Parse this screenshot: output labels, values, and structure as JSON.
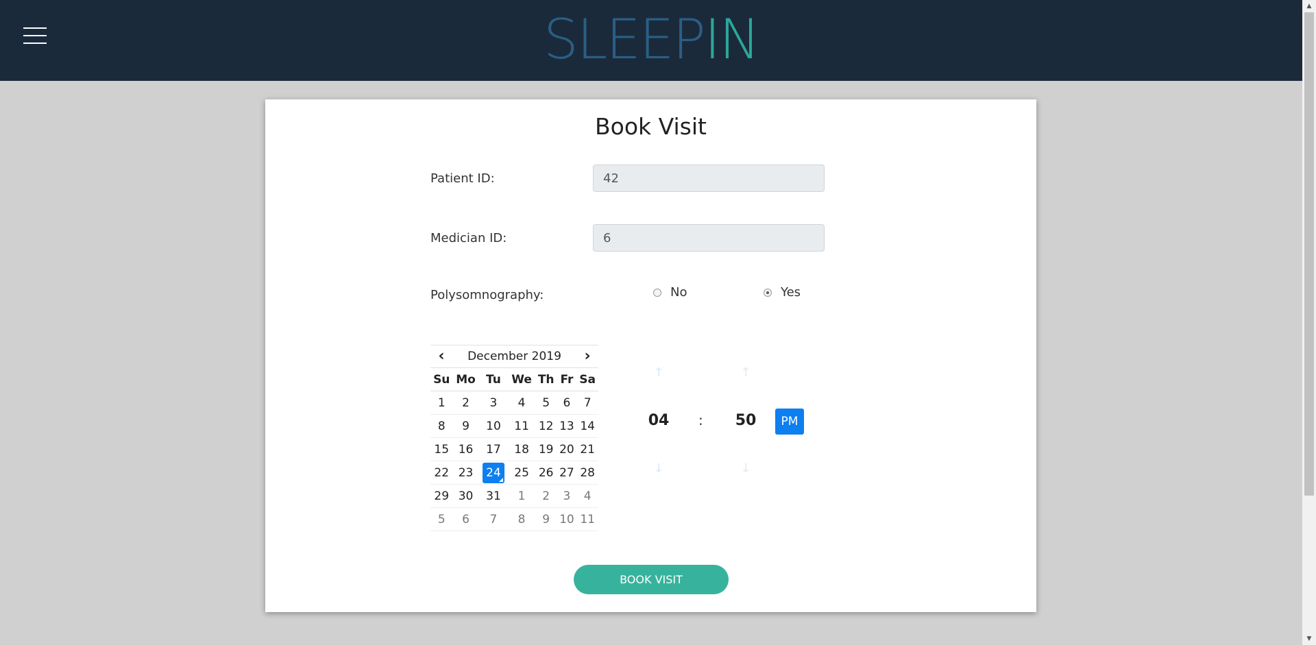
{
  "header": {
    "logo_part1": "SLEEP",
    "logo_part2": "IN",
    "logo_color_1": "#2a5f86",
    "logo_color_2": "#2aa89a",
    "background": "#1b2a3b"
  },
  "form": {
    "title": "Book Visit",
    "patient_label": "Patient ID:",
    "patient_value": "42",
    "medician_label": "Medician ID:",
    "medician_value": "6",
    "polysomnography_label": "Polysomnography:",
    "radio_no": "No",
    "radio_yes": "Yes",
    "radio_selected": "Yes",
    "submit_label": "BOOK VISIT",
    "submit_color": "#37b39d"
  },
  "calendar": {
    "month_label": "December 2019",
    "prev_icon": "‹",
    "next_icon": "›",
    "weekdays": [
      "Su",
      "Mo",
      "Tu",
      "We",
      "Th",
      "Fr",
      "Sa"
    ],
    "weeks": [
      [
        "1",
        "2",
        "3",
        "4",
        "5",
        "6",
        "7"
      ],
      [
        "8",
        "9",
        "10",
        "11",
        "12",
        "13",
        "14"
      ],
      [
        "15",
        "16",
        "17",
        "18",
        "19",
        "20",
        "21"
      ],
      [
        "22",
        "23",
        "24",
        "25",
        "26",
        "27",
        "28"
      ],
      [
        "29",
        "30",
        "31",
        "1",
        "2",
        "3",
        "4"
      ],
      [
        "5",
        "6",
        "7",
        "8",
        "9",
        "10",
        "11"
      ]
    ],
    "selected_day": "24",
    "accent": "#0d7ff0"
  },
  "time": {
    "hour": "04",
    "separator": ":",
    "minute": "50",
    "period": "PM",
    "up_icon": "arrow-up-icon",
    "down_icon": "arrow-down-icon"
  }
}
